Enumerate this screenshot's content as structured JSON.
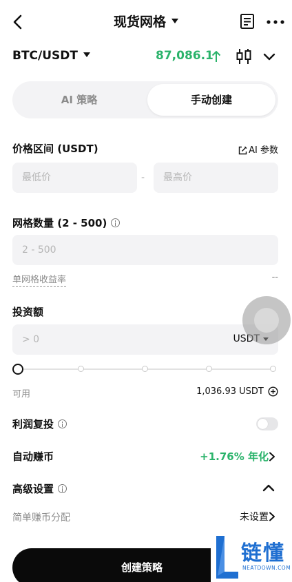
{
  "header": {
    "title": "现货网格",
    "icons": {
      "back": "chevron-left-icon",
      "doc": "document-icon",
      "more": "more-icon"
    }
  },
  "pair": {
    "symbol": "BTC/USDT",
    "price": "87,086.1",
    "price_color": "#2bb36b"
  },
  "segment": {
    "tabs": [
      {
        "label": "AI 策略",
        "active": false
      },
      {
        "label": "手动创建",
        "active": true
      }
    ]
  },
  "price_range": {
    "label": "价格区间 (USDT)",
    "ai_param": "AI 参数",
    "min_placeholder": "最低价",
    "separator": "-",
    "max_placeholder": "最高价"
  },
  "grid_count": {
    "label": "网格数量 (2 - 500)",
    "placeholder": "2 - 500",
    "yield_label": "单网格收益率",
    "yield_value": "--"
  },
  "investment": {
    "label": "投资额",
    "placeholder": "> 0",
    "currency": "USDT",
    "slider_percent": 0,
    "available_label": "可用",
    "available_value": "1,036.93 USDT"
  },
  "profit_reinvest": {
    "label": "利润复投",
    "enabled": false
  },
  "auto_earn": {
    "label": "自动赚币",
    "value": "+1.76% 年化"
  },
  "advanced": {
    "label": "高级设置",
    "expanded": true
  },
  "simple_earn": {
    "label": "简单赚币分配",
    "value": "未设置"
  },
  "create_button": {
    "label": "创建策略"
  },
  "watermark": {
    "cn": "链懂",
    "en": "NEATDOWN.COM"
  },
  "colors": {
    "accent_green": "#2bb36b",
    "button_black": "#0a0a0a",
    "input_bg": "#f3f3f5"
  }
}
